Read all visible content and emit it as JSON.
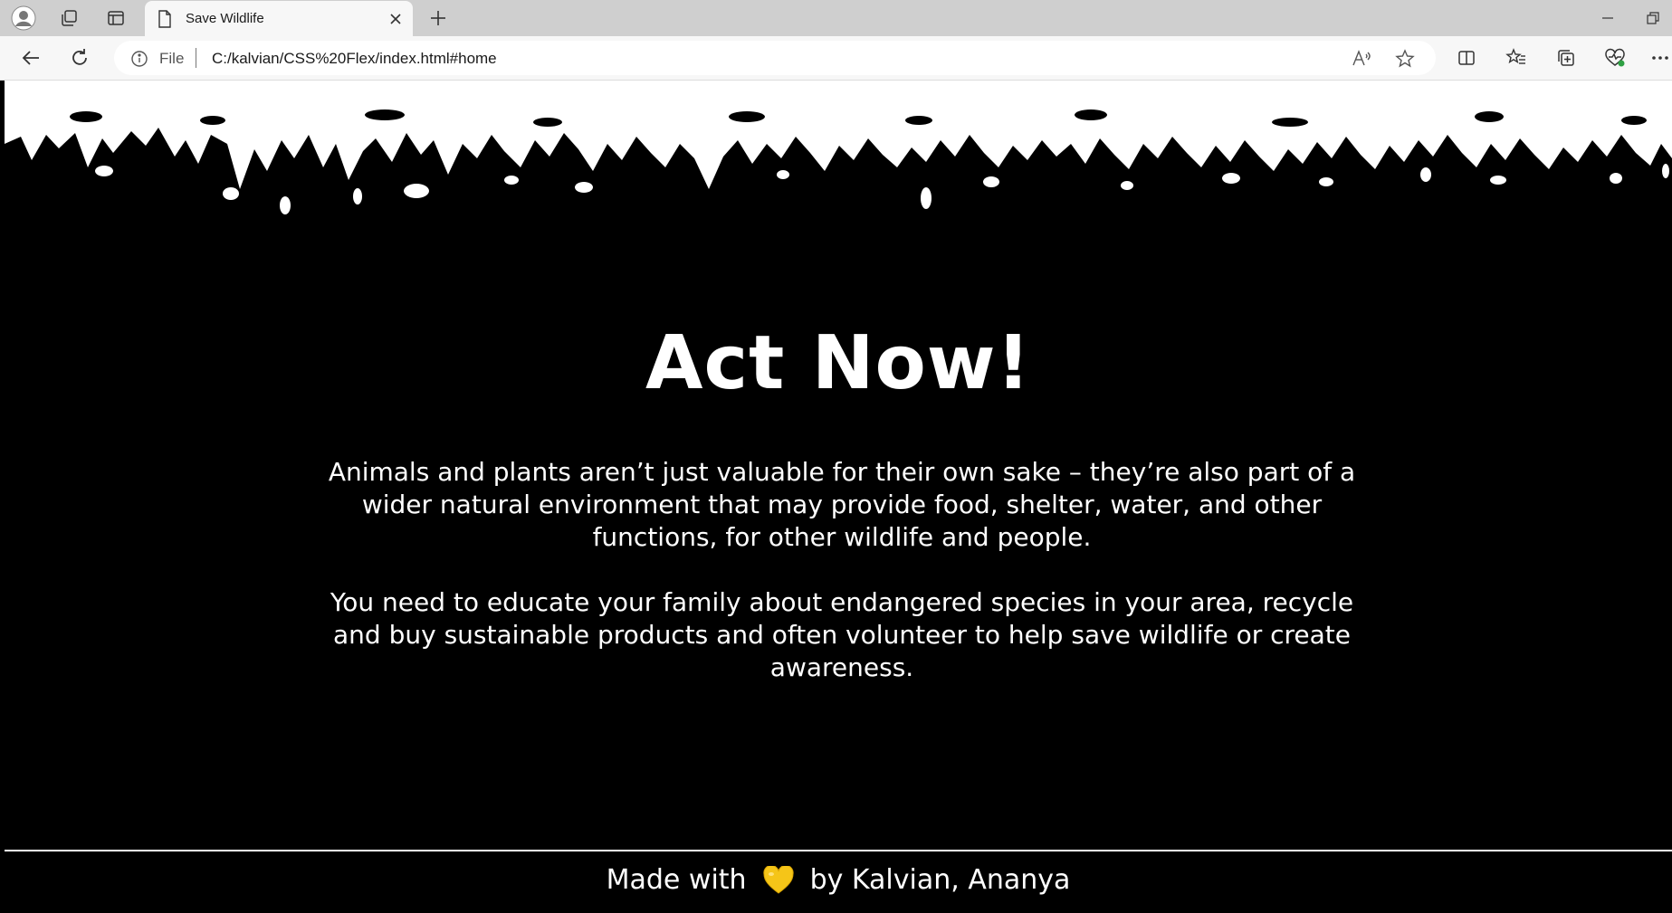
{
  "browser": {
    "tab_title": "Save Wildlife",
    "address_prefix": "File",
    "url": "C:/kalvian/CSS%20Flex/index.html#home"
  },
  "hero": {
    "title": "Act Now!",
    "paragraph1": "Animals and plants aren’t just valuable for their own sake – they’re also part of a wider natural environment that may provide food, shelter, water, and other functions, for other wildlife and people.",
    "paragraph2": "You need to educate your family about endangered species in your area, recycle and buy sustainable products and often volunteer to help save wildlife or create awareness."
  },
  "footer": {
    "made_with": "Made with",
    "by": "by Kalvian, Ananya"
  },
  "colors": {
    "page_background": "#000000",
    "text": "#ffffff",
    "heart": "#f5c518"
  }
}
